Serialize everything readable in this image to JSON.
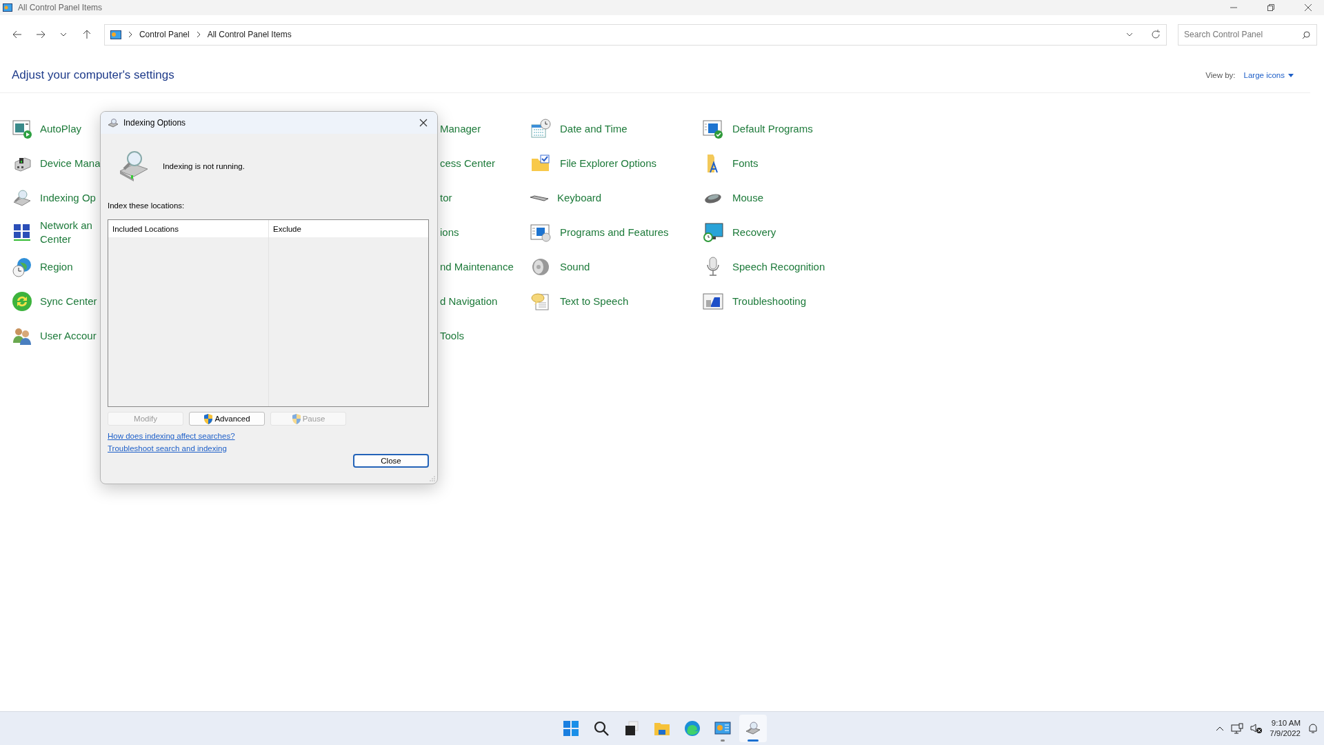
{
  "window": {
    "title": "All Control Panel Items"
  },
  "address_bar": {
    "breadcrumbs": [
      "Control Panel",
      "All Control Panel Items"
    ]
  },
  "search": {
    "placeholder": "Search Control Panel"
  },
  "heading": "Adjust your computer's settings",
  "view_by": {
    "label": "View by:",
    "value": "Large icons"
  },
  "columns": [
    {
      "items": [
        {
          "lines": [
            "AutoPlay"
          ]
        },
        {
          "lines": [
            "Device Mana"
          ]
        },
        {
          "lines": [
            "Indexing Op"
          ]
        },
        {
          "lines": [
            "Network an",
            "Center"
          ]
        },
        {
          "lines": [
            "Region"
          ]
        },
        {
          "lines": [
            "Sync Center"
          ]
        },
        {
          "lines": [
            "User Accour"
          ]
        }
      ]
    },
    {
      "items": [
        {
          "lines": [
            "Manager"
          ]
        },
        {
          "lines": [
            "cess Center"
          ]
        },
        {
          "lines": [
            "tor"
          ]
        },
        {
          "lines": [
            "ions"
          ]
        },
        {
          "lines": [
            "nd Maintenance"
          ]
        },
        {
          "lines": [
            "d Navigation"
          ]
        },
        {
          "lines": [
            "Tools"
          ]
        }
      ]
    },
    {
      "items": [
        {
          "lines": [
            "Date and Time"
          ]
        },
        {
          "lines": [
            "File Explorer Options"
          ]
        },
        {
          "lines": [
            "Keyboard"
          ]
        },
        {
          "lines": [
            "Programs and Features"
          ]
        },
        {
          "lines": [
            "Sound"
          ]
        },
        {
          "lines": [
            "Text to Speech"
          ]
        }
      ]
    },
    {
      "items": [
        {
          "lines": [
            "Default Programs"
          ]
        },
        {
          "lines": [
            "Fonts"
          ]
        },
        {
          "lines": [
            "Mouse"
          ]
        },
        {
          "lines": [
            "Recovery"
          ]
        },
        {
          "lines": [
            "Speech Recognition"
          ]
        },
        {
          "lines": [
            "Troubleshooting"
          ]
        }
      ]
    }
  ],
  "dialog": {
    "title": "Indexing Options",
    "status": "Indexing is not running.",
    "list_label": "Index these locations:",
    "table": {
      "columns": [
        "Included Locations",
        "Exclude"
      ]
    },
    "buttons": [
      {
        "label": "Modify",
        "disabled": true,
        "kind": "plain"
      },
      {
        "label": "Advanced",
        "disabled": false,
        "kind": "shield"
      },
      {
        "label": "Pause",
        "disabled": true,
        "kind": "shield"
      }
    ],
    "links": [
      "How does indexing affect searches?",
      "Troubleshoot search and indexing"
    ],
    "close_button": "Close"
  },
  "taskbar": {
    "apps": [
      {
        "open": false,
        "selected": false
      },
      {
        "open": false,
        "selected": false
      },
      {
        "open": false,
        "selected": false
      },
      {
        "open": false,
        "selected": false
      },
      {
        "open": false,
        "selected": false
      },
      {
        "open": true,
        "selected": false
      },
      {
        "open": true,
        "selected": true
      }
    ]
  },
  "clock": {
    "time": "9:10 AM",
    "date": "7/9/2022"
  }
}
